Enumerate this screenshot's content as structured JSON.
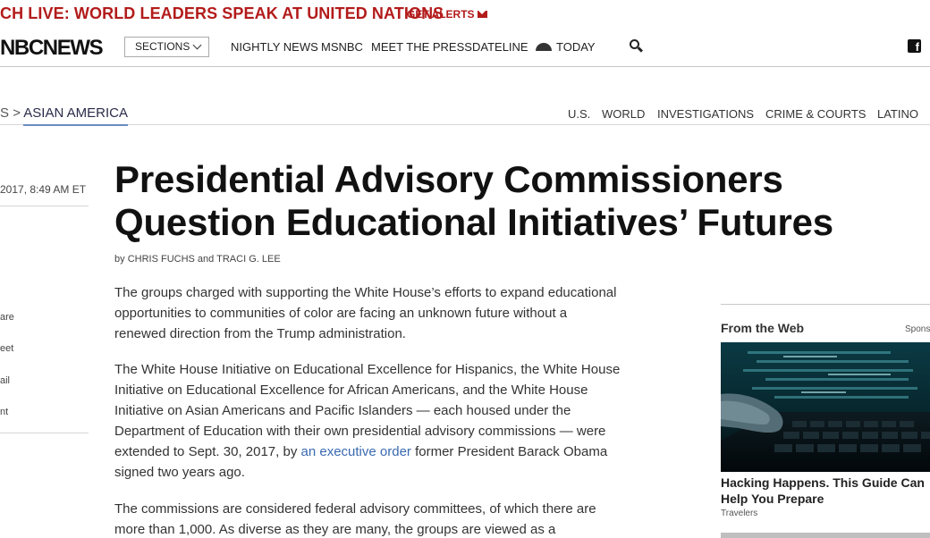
{
  "banner": {
    "headline": "CH LIVE: WORLD LEADERS SPEAK AT UNITED NATIONS",
    "alerts_label": "GET ALERTS",
    "alerts_icon": "envelope-icon",
    "color": "#b31b1b"
  },
  "nav": {
    "logo": "NBCNEWS",
    "sections_label": "SECTIONS",
    "links": [
      "NIGHTLY NEWS",
      "MSNBC",
      "MEET THE PRESS",
      "DATELINE",
      "TODAY"
    ],
    "search_icon": "search-icon",
    "social_icon": "facebook-icon"
  },
  "subnav": {
    "breadcrumb_prefix": "S",
    "breadcrumb_separator": ">",
    "breadcrumb_current": "ASIAN AMERICA",
    "links": [
      "U.S.",
      "WORLD",
      "INVESTIGATIONS",
      "CRIME & COURTS",
      "LATINO"
    ]
  },
  "rail": {
    "date": "2017, 8:49 AM ET",
    "share_items": [
      "are",
      "eet",
      "ail",
      "nt"
    ]
  },
  "article": {
    "headline_line1": "Presidential Advisory Commissioners",
    "headline_line2": "Question Educational Initiatives’ Futures",
    "byline_prefix": "by",
    "byline_authors": "CHRIS FUCHS",
    "byline_and": "and",
    "byline_author2": "TRACI G. LEE",
    "p1": "The groups charged with supporting the White House’s efforts to expand educational opportunities to communities of color are facing an unknown future without a renewed direction from the Trump administration.",
    "p2_before": "The White House Initiative on Educational Excellence for Hispanics, the White House Initiative on Educational Excellence for African Americans, and the White House Initiative on Asian Americans and Pacific Islanders — each housed under the Department of Education with their own presidential advisory commissions — were extended to Sept. 30, 2017, by ",
    "p2_link": "an executive order",
    "p2_after": " former President Barack Obama signed two years ago.",
    "p3": "The commissions are considered federal advisory committees, of which there are more than 1,000. As diverse as they are many, the groups are viewed as a"
  },
  "from_web": {
    "title": "From the Web",
    "sponsored": "Spons",
    "card_title": "Hacking Happens. This Guide Can Help You Prepare",
    "card_source": "Travelers"
  }
}
